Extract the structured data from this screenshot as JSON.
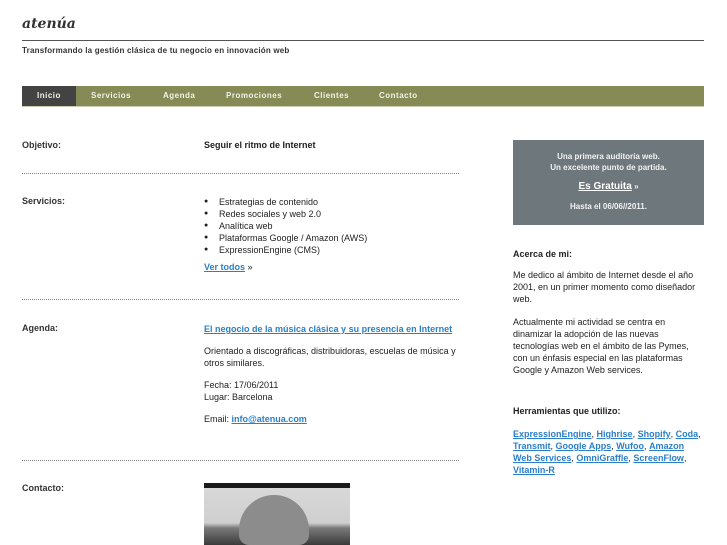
{
  "header": {
    "logo": "atenúa",
    "tagline": "Transformando la gestión clásica de tu negocio en innovación web"
  },
  "nav": [
    "Inicio",
    "Servicios",
    "Agenda",
    "Promociones",
    "Clientes",
    "Contacto"
  ],
  "objetivo": {
    "label": "Objetivo:",
    "value": "Seguir el ritmo de Internet"
  },
  "servicios": {
    "label": "Servicios:",
    "items": [
      "Estrategias de contenido",
      "Redes sociales y web 2.0",
      "Analítica web",
      "Plataformas Google / Amazon (AWS)",
      "ExpressionEngine (CMS)"
    ],
    "link": "Ver todos",
    "arrow": "»"
  },
  "agenda": {
    "label": "Agenda:",
    "title": "El negocio de la música clásica y su presencia en Internet",
    "desc": "Orientado a discográficas, distribuidoras, escuelas de música y otros similares.",
    "fecha": "Fecha: 17/06/2011",
    "lugar": "Lugar: Barcelona",
    "email_label": "Email:",
    "email": "info@atenua.com"
  },
  "contacto": {
    "label": "Contacto:"
  },
  "promo": {
    "line1": "Una primera auditoría web.",
    "line2": "Un excelente punto de partida.",
    "link": "Es Gratuita",
    "arrow": "»",
    "until": "Hasta el 06/06//2011."
  },
  "about": {
    "title": "Acerca de mi:",
    "p1": "Me dedico al ámbito de Internet desde el año 2001, en un primer momento como diseñador web.",
    "p2": "Actualmente mi actividad se centra en dinamizar la adopción de las nuevas tecnologías web en el ámbito de las Pymes, con un énfasis especial en las plataformas Google y Amazon Web services."
  },
  "tools": {
    "title": "Herramientas que utilizo:",
    "items": [
      "ExpressionEngine",
      "Highrise",
      "Shopify",
      "Coda",
      "Transmit",
      "Google Apps",
      "Wufoo",
      "Amazon Web Services",
      "OmniGraffle",
      "ScreenFlow",
      "Vitamin-R"
    ]
  }
}
